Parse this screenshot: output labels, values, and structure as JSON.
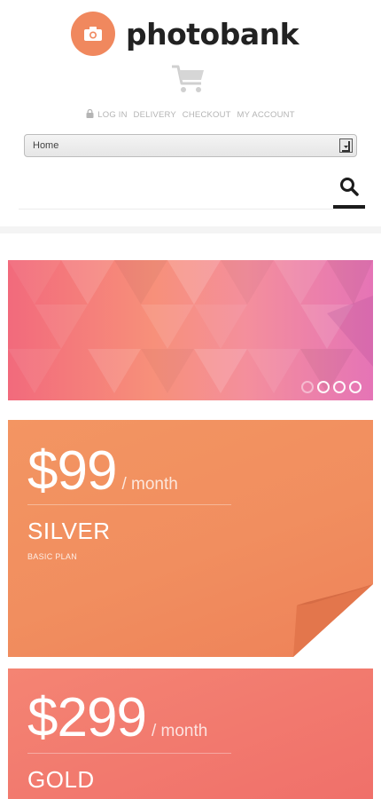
{
  "brand": {
    "name": "photobank",
    "accent": "#f0885e",
    "icon": "camera-icon"
  },
  "header": {
    "cart_icon": "shopping-cart-icon",
    "lock_icon": "lock-icon",
    "links": [
      "LOG IN",
      "DELIVERY",
      "CHECKOUT",
      "MY ACCOUNT"
    ],
    "nav_select": {
      "value": "Home"
    },
    "search_icon": "search-icon"
  },
  "slider": {
    "colors": [
      "#f26a7c",
      "#f7907a",
      "#e574b6"
    ],
    "dots_count": 4,
    "active_dot": 1
  },
  "plans": [
    {
      "price": "$99",
      "period": "/ month",
      "name": "SILVER",
      "subtitle": "BASIC PLAN",
      "color": "#f18e5f"
    },
    {
      "price": "$299",
      "period": "/ month",
      "name": "GOLD",
      "color": "#f0706a"
    }
  ]
}
